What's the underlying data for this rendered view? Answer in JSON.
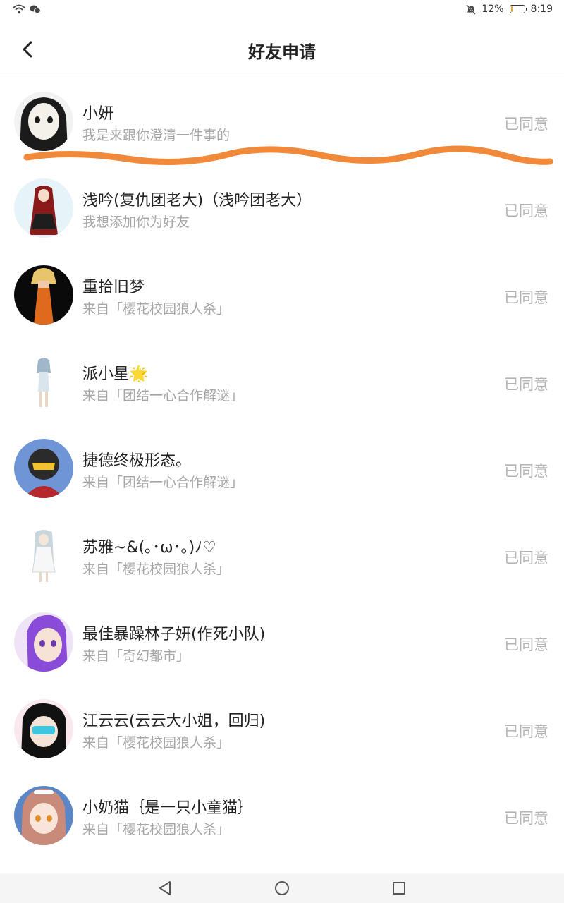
{
  "status_bar": {
    "battery_percent": "12%",
    "battery_level": 0.12,
    "time": "8:19",
    "left_icons": [
      "wifi-icon",
      "wechat-icon"
    ],
    "right_icons": [
      "mute-bell-icon",
      "battery-icon"
    ]
  },
  "header": {
    "title": "好友申请",
    "back_icon": "chevron-left-icon"
  },
  "requests": [
    {
      "name": "小妍",
      "message": "我是来跟你澄清一件事的",
      "status": "已同意",
      "avatar_colors": [
        "#f2f2f2",
        "#1b1b1b"
      ]
    },
    {
      "name": "浅吟(复仇团老大)（浅吟团老大）",
      "message": "我想添加你为好友",
      "status": "已同意",
      "avatar_colors": [
        "#e6f3f8",
        "#8b1a1a"
      ]
    },
    {
      "name": "重拾旧梦",
      "message": "来自「樱花校园狼人杀」",
      "status": "已同意",
      "avatar_colors": [
        "#0a0a0a",
        "#e06a1c"
      ]
    },
    {
      "name": "派小星🌟",
      "message": "来自「团结一心合作解谜」",
      "status": "已同意",
      "avatar_colors": [
        "#ffffff",
        "#9fb7c9"
      ]
    },
    {
      "name": "捷德终极形态。",
      "message": "来自「团结一心合作解谜」",
      "status": "已同意",
      "avatar_colors": [
        "#6f95d6",
        "#b3272d"
      ]
    },
    {
      "name": "苏雅~&(｡･ω･｡)ﾉ♡",
      "message": "来自「樱花校园狼人杀」",
      "status": "已同意",
      "avatar_colors": [
        "#ffffff",
        "#c9d6de"
      ]
    },
    {
      "name": "最佳暴躁林子妍(作死小队)",
      "message": "来自「奇幻都市」",
      "status": "已同意",
      "avatar_colors": [
        "#efe3f7",
        "#8a4bd8"
      ]
    },
    {
      "name": "江云云(云云大小姐，回归)",
      "message": "来自「樱花校园狼人杀」",
      "status": "已同意",
      "avatar_colors": [
        "#f9e9ef",
        "#111111"
      ]
    },
    {
      "name": "小奶猫｛是一只小童猫｝",
      "message": "来自「樱花校园狼人杀」",
      "status": "已同意",
      "avatar_colors": [
        "#5a86c6",
        "#c98a7a"
      ]
    }
  ],
  "annotation": {
    "color": "#f08a3a"
  },
  "nav_bar": {
    "icons": [
      "back-triangle-icon",
      "home-circle-icon",
      "recents-square-icon"
    ]
  }
}
